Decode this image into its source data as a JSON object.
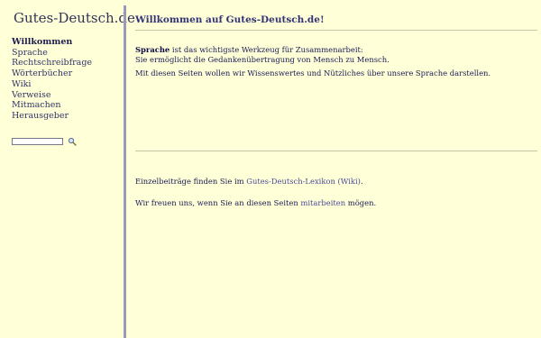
{
  "sidebar": {
    "site_title": "Gutes-Deutsch.de",
    "nav": [
      {
        "label": "Willkommen",
        "active": true
      },
      {
        "label": "Sprache"
      },
      {
        "label": "Rechtschreibfrage"
      },
      {
        "label": "Wörterbücher"
      },
      {
        "label": "Wiki"
      },
      {
        "label": "Verweise"
      },
      {
        "label": "Mitmachen"
      },
      {
        "label": "Herausgeber"
      }
    ],
    "search": {
      "value": "",
      "icon": "magnifier-icon"
    }
  },
  "main": {
    "heading": "Willkommen auf Gutes-Deutsch.de!",
    "intro_bold": "Sprache",
    "intro_rest": " ist das wichtigste Werkzeug für Zusammenarbeit:",
    "intro_line2": "Sie ermöglicht die Gedankenübertragung von Mensch zu Mensch.",
    "mission": "Mit diesen Seiten wollen wir Wissenswertes und Nützliches über unsere Sprache darstellen.",
    "wiki_before": "Einzelbeiträge finden Sie im ",
    "wiki_link": "Gutes-Deutsch-Lexikon (Wiki)",
    "wiki_after": ".",
    "join_before": "Wir freuen uns, wenn Sie an diesen Seiten ",
    "join_link": "mitarbeiten",
    "join_after": " mögen."
  },
  "colors": {
    "background": "#ffffd8",
    "divider": "#9a9ab8",
    "text": "#1a1a55",
    "link": "#4a4a99"
  }
}
